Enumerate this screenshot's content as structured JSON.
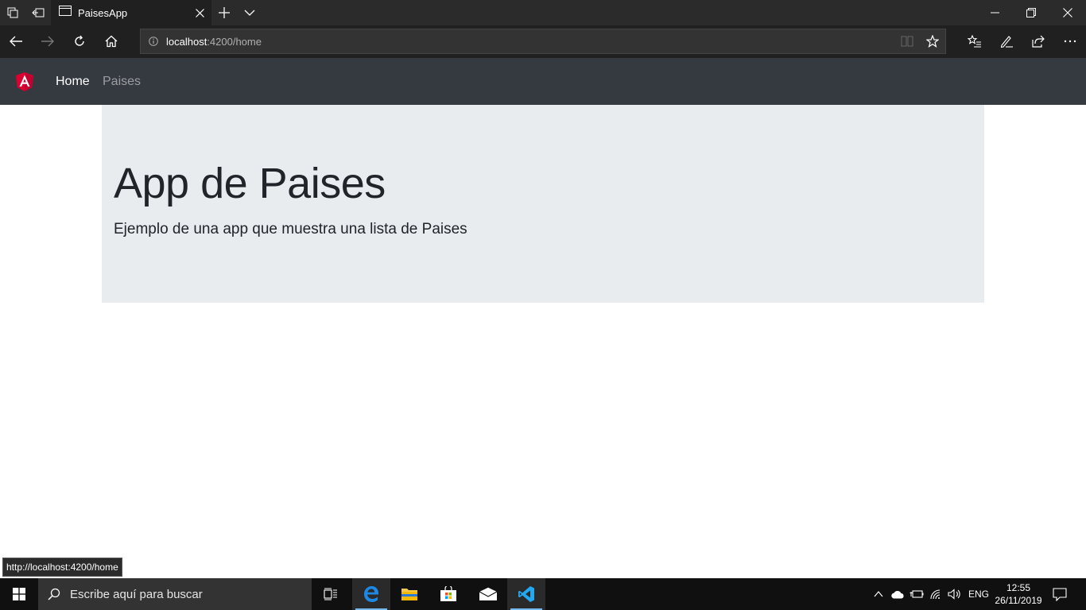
{
  "browser": {
    "tab_title": "PaisesApp",
    "url_host": "localhost",
    "url_path": ":4200/home"
  },
  "app": {
    "nav": {
      "home_label": "Home",
      "paises_label": "Paises"
    },
    "jumbotron": {
      "title": "App de Paises",
      "lead": "Ejemplo de una app que muestra una lista de Paises"
    }
  },
  "status_bar": {
    "link_preview": "http://localhost:4200/home"
  },
  "taskbar": {
    "search_placeholder": "Escribe aquí para buscar",
    "language": "ENG",
    "time": "12:55",
    "date": "26/11/2019"
  },
  "colors": {
    "navbar_bg": "#343a40",
    "jumbotron_bg": "#e9ecef",
    "angular_red": "#dd0031",
    "edge_blue": "#1e88e5",
    "vscode_blue": "#23a9f2"
  }
}
